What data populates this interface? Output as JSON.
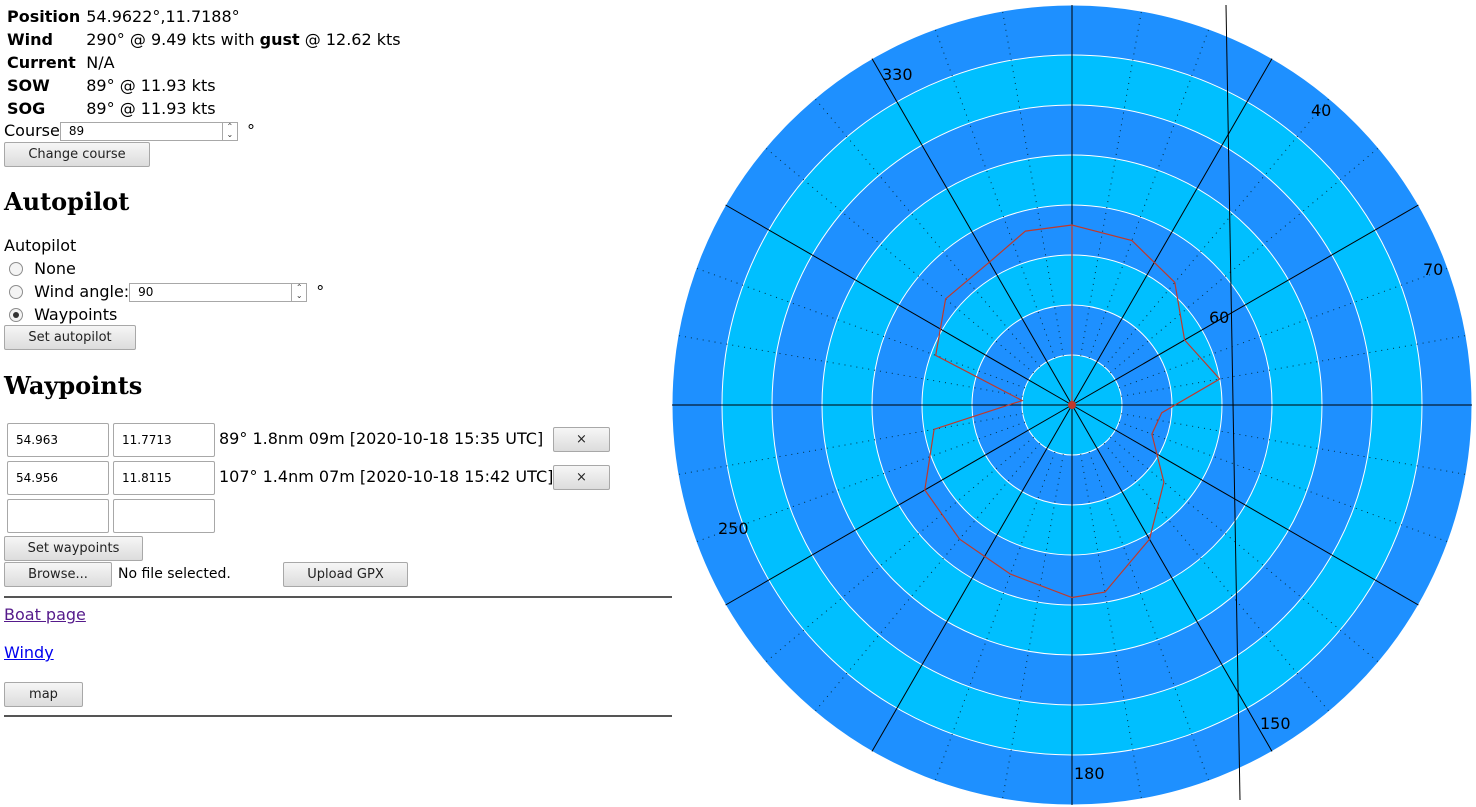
{
  "info": {
    "position": {
      "label": "Position",
      "value": "54.9622°,11.7188°"
    },
    "wind": {
      "label": "Wind",
      "value_a": "290° @ 9.49 kts with ",
      "gust_word": "gust",
      "value_b": " @ 12.62 kts"
    },
    "current": {
      "label": "Current",
      "value": "N/A"
    },
    "sow": {
      "label": "SOW",
      "value": "89° @ 11.93 kts"
    },
    "sog": {
      "label": "SOG",
      "value": "89° @ 11.93 kts"
    }
  },
  "course": {
    "label": "Course",
    "value": "89",
    "unit": "°",
    "button": "Change course"
  },
  "autopilot": {
    "heading": "Autopilot",
    "label": "Autopilot",
    "options": [
      "None",
      "Wind angle:",
      "Waypoints"
    ],
    "selected": "Waypoints",
    "wind_angle": "90",
    "unit": "°",
    "button": "Set autopilot"
  },
  "waypoints": {
    "heading": "Waypoints",
    "rows": [
      {
        "lat": "54.963",
        "lon": "11.7713",
        "info": "89°   1.8nm 09m [2020-10-18 15:35 UTC]",
        "remove": "×"
      },
      {
        "lat": "54.956",
        "lon": "11.8115",
        "info": "107° 1.4nm 07m [2020-10-18 15:42 UTC]",
        "remove": "×"
      }
    ],
    "set_button": "Set waypoints",
    "browse_button": "Browse...",
    "file_status": "No file selected.",
    "upload_button": "Upload GPX"
  },
  "links": {
    "boat_page": "Boat page",
    "windy": "Windy",
    "map_button": "map"
  },
  "polar": {
    "outer_color": "#1e90ff",
    "inner_color": "#00bfff",
    "curve_color": "#c0392b",
    "angle_labels": [
      "330",
      "40",
      "70",
      "60",
      "250",
      "150",
      "180"
    ],
    "curve_polar_deg_r": [
      [
        0,
        3.6
      ],
      [
        20,
        3.5
      ],
      [
        40,
        3.2
      ],
      [
        60,
        2.6
      ],
      [
        80,
        3.0
      ],
      [
        95,
        1.8
      ],
      [
        110,
        1.7
      ],
      [
        130,
        2.4
      ],
      [
        150,
        3.1
      ],
      [
        170,
        3.8
      ],
      [
        180,
        3.85
      ],
      [
        200,
        3.6
      ],
      [
        220,
        3.5
      ],
      [
        240,
        3.4
      ],
      [
        260,
        2.8
      ],
      [
        275,
        1.0
      ],
      [
        290,
        2.9
      ],
      [
        310,
        3.3
      ],
      [
        330,
        3.3
      ],
      [
        345,
        3.6
      ]
    ]
  }
}
